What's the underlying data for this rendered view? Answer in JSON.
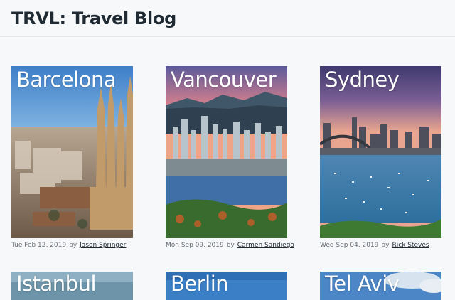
{
  "site": {
    "title": "TRVL: Travel Blog"
  },
  "posts": [
    {
      "city": "Barcelona",
      "date": "Tue Feb 12, 2019",
      "by": "by",
      "author": "Jason Springer"
    },
    {
      "city": "Vancouver",
      "date": "Mon Sep 09, 2019",
      "by": "by",
      "author": "Carmen Sandiego"
    },
    {
      "city": "Sydney",
      "date": "Wed Sep 04, 2019",
      "by": "by",
      "author": "Rick Steves"
    },
    {
      "city": "Istanbul"
    },
    {
      "city": "Berlin"
    },
    {
      "city": "Tel Aviv"
    }
  ],
  "colors": {
    "text": "#1f2a33",
    "muted": "#666d73",
    "background": "#f7f8fa"
  }
}
